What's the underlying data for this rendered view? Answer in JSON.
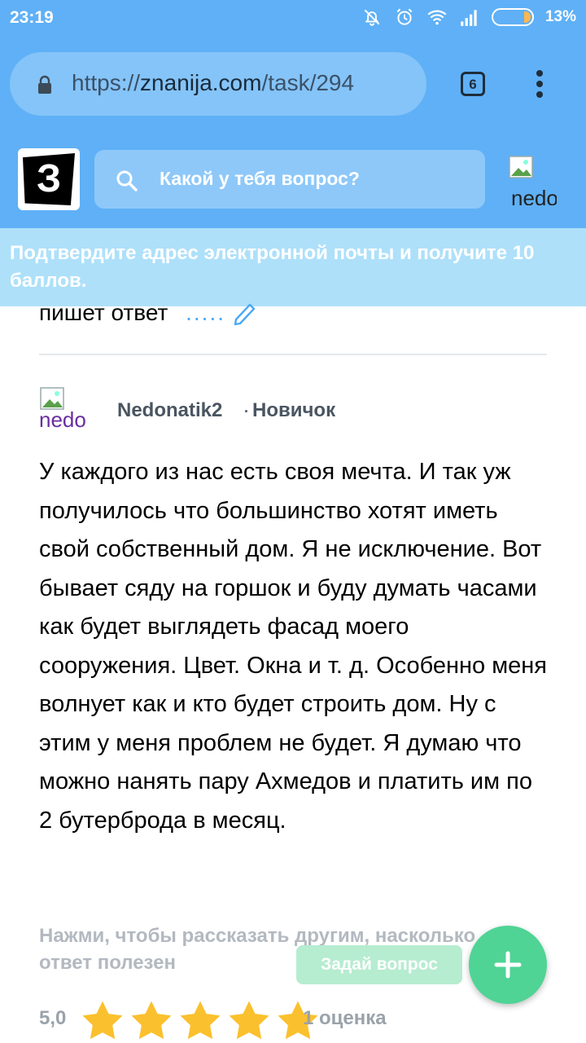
{
  "status_bar": {
    "time": "23:19",
    "battery_percent": "13%",
    "battery_level": 0.13
  },
  "browser": {
    "url_scheme": "https://",
    "url_host": "znanija.com",
    "url_path": "/task/294",
    "tab_count": "6"
  },
  "site_header": {
    "logo_letter": "З",
    "search_placeholder": "Какой у тебя вопрос?",
    "avatar_text": "nedo"
  },
  "notice": {
    "text": "Подтвердите адрес электронной почты и получите 10 баллов."
  },
  "previous": {
    "tail_text": "пишет ответ",
    "dots": "....."
  },
  "answer": {
    "avatar_text": "nedo",
    "author": "Nedonatik2",
    "rank": "Новичок",
    "text": "У каждого из нас есть своя мечта. И так уж получилось что большинство хотят иметь свой собственный дом. Я не исключение. Вот бывает сяду на горшок и буду думать часами как будет выглядеть фасад моего сооружения. Цвет. Окна и т. д. Особенно меня волнует как и кто будет строить дом. Ну с этим у меня проблем не будет. Я думаю что можно нанять пару Ахмедов и платить им по 2 бутерброда в месяц."
  },
  "footer": {
    "helpful_prompt": "Нажми, чтобы рассказать другим, насколько ответ полезен",
    "ask_button_label": "Задай вопрос",
    "rating_value": "5,0",
    "rating_stars": 5,
    "rating_count": "1 оценка"
  },
  "colors": {
    "header_blue": "#5fb0f6",
    "notice_blue": "#aee0fa",
    "fab_green": "#4fd495",
    "star_yellow": "#fbc02d"
  }
}
